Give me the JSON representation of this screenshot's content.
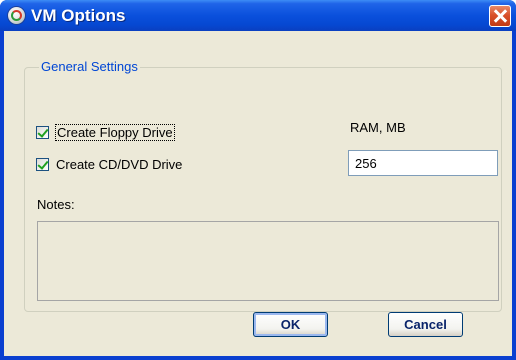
{
  "window": {
    "title": "VM Options"
  },
  "general": {
    "group_label": "General Settings",
    "create_floppy": {
      "label": "Create Floppy Drive",
      "checked": true
    },
    "create_cd": {
      "label": "Create CD/DVD Drive",
      "checked": true
    },
    "ram_label": "RAM, MB",
    "ram_value": "256",
    "notes_label": "Notes:",
    "notes_value": ""
  },
  "buttons": {
    "ok": "OK",
    "cancel": "Cancel"
  },
  "icons": {
    "app": "app-icon",
    "close": "close-icon",
    "check": "checkmark-icon"
  },
  "colors": {
    "title_bar": "#0a50dc",
    "client_bg": "#ece9d8",
    "group_label": "#0046d5",
    "close": "#d9502a"
  }
}
